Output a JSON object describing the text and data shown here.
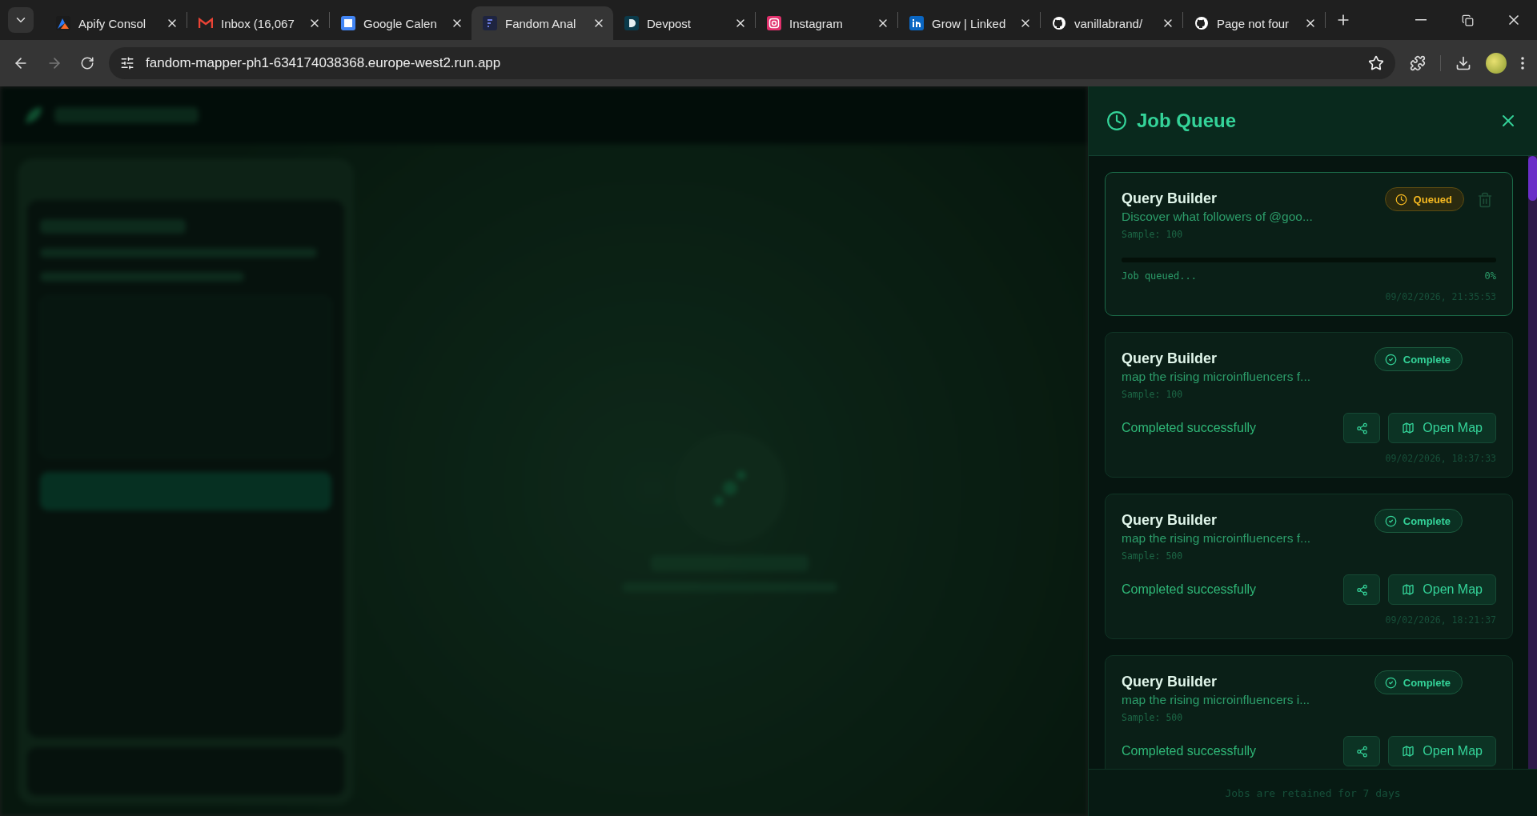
{
  "browser": {
    "tabs": [
      {
        "title": "Apify Consol",
        "kind": "apify",
        "selected": false
      },
      {
        "title": "Inbox (16,067",
        "kind": "mail",
        "selected": false
      },
      {
        "title": "Google Calen",
        "kind": "calendar",
        "selected": false
      },
      {
        "title": "Fandom Anal",
        "kind": "app",
        "selected": true
      },
      {
        "title": "Devpost",
        "kind": "devpost",
        "selected": false
      },
      {
        "title": "Instagram",
        "kind": "instagram",
        "selected": false
      },
      {
        "title": "Grow | Linked",
        "kind": "linkedin",
        "selected": false
      },
      {
        "title": "vanillabrand/",
        "kind": "github",
        "selected": false
      },
      {
        "title": "Page not four",
        "kind": "github",
        "selected": false
      }
    ],
    "address": "fandom-mapper-ph1-634174038368.europe-west2.run.app"
  },
  "job_queue": {
    "title": "Job Queue",
    "jobs": [
      {
        "title": "Query Builder",
        "description": "Discover what followers of @goo...",
        "sample": "Sample: 100",
        "kind": "queued",
        "badge": "Queued",
        "progress_label": "Job queued...",
        "percent": "0%",
        "timestamp": "09/02/2026, 21:35:53"
      },
      {
        "title": "Query Builder",
        "description": "map the rising microinfluencers f...",
        "sample": "Sample: 100",
        "kind": "complete",
        "badge": "Complete",
        "message": "Completed successfully",
        "action": "Open Map",
        "timestamp": "09/02/2026, 18:37:33"
      },
      {
        "title": "Query Builder",
        "description": "map the rising microinfluencers f...",
        "sample": "Sample: 500",
        "kind": "complete",
        "badge": "Complete",
        "message": "Completed successfully",
        "action": "Open Map",
        "timestamp": "09/02/2026, 18:21:37"
      },
      {
        "title": "Query Builder",
        "description": "map the rising microinfluencers i...",
        "sample": "Sample: 500",
        "kind": "complete",
        "badge": "Complete",
        "message": "Completed successfully",
        "action": "Open Map"
      }
    ],
    "footer": "Jobs are retained for 7 days"
  }
}
